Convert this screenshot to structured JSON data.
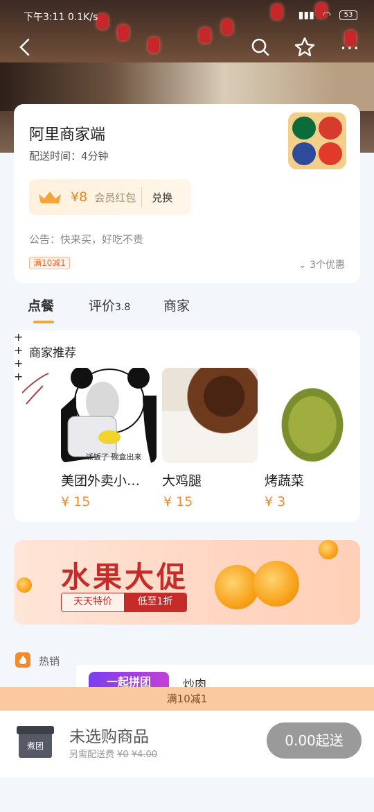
{
  "status_bar": {
    "time": "下午3:11",
    "speed": "0.1K/s",
    "battery": "53"
  },
  "store": {
    "name": "阿里商家端",
    "delivery_time": "配送时间：4分钟",
    "coupon": {
      "amount": "¥8",
      "label": "会员红包",
      "action": "兑换"
    },
    "notice": "公告：快来买，好吃不贵",
    "tag": "满10减1",
    "promos": "3个优惠"
  },
  "tabs": [
    {
      "label": "点餐",
      "active": true
    },
    {
      "label": "评价",
      "score": "3.8",
      "active": false
    },
    {
      "label": "商家",
      "active": false
    }
  ],
  "recommend": {
    "title": "商家推荐",
    "items": [
      {
        "name": "美团外卖小…",
        "price": "¥ 15",
        "caption": "派饭了 碗盒出来"
      },
      {
        "name": "大鸡腿",
        "price": "¥ 15"
      },
      {
        "name": "烤蔬菜",
        "price": "¥ 3"
      }
    ]
  },
  "banner": {
    "title": "水果大促",
    "left_tag": "天天特价",
    "right_tag": "低至1折"
  },
  "categories": {
    "hot": "热销"
  },
  "products": {
    "group_badge": "一起拼团",
    "first_name": "炒肉"
  },
  "promo_bar": "满10减1",
  "cart": {
    "box_label": "煮团",
    "title": "未选购商品",
    "sub_prefix": "另需配送费",
    "sub_original": "¥0",
    "sub_fee": "¥4.00",
    "button": "0.00起送"
  },
  "colors": {
    "accent": "#f19b33",
    "price": "#ef8a2f",
    "banner_red": "#c52b28"
  }
}
